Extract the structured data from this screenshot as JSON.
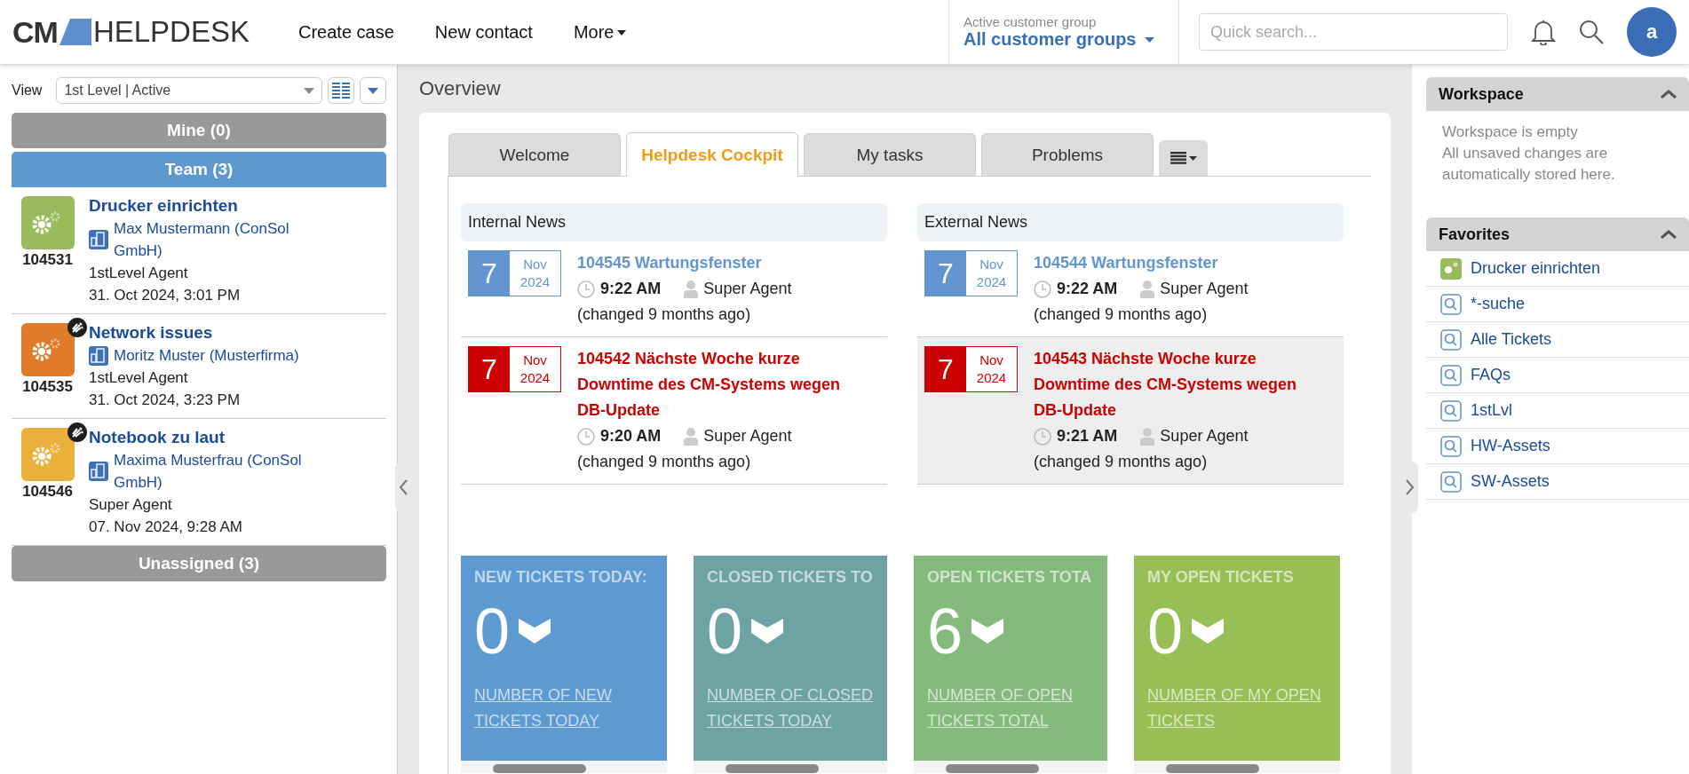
{
  "header": {
    "logo_left": "CM",
    "logo_right": "HELPDESK",
    "nav": [
      "Create case",
      "New contact",
      "More"
    ],
    "customer_group": {
      "label": "Active customer group",
      "value": "All customer groups"
    },
    "search": {
      "placeholder": "Quick search..."
    },
    "avatar": "a"
  },
  "sidebar": {
    "view_label": "View",
    "view_value": "1st Level | Active",
    "sections": [
      {
        "label": "Mine (0)",
        "selected": false
      },
      {
        "label": "Team (3)",
        "selected": true,
        "tickets": [
          {
            "title": "Drucker einrichten",
            "number": "104531",
            "contact": "Max Mustermann (ConSol GmbH)",
            "agent": "1stLevel Agent",
            "date": "31. Oct 2024, 3:01 PM",
            "color": "#9aba5e",
            "escalated": false
          },
          {
            "title": "Network issues",
            "number": "104535",
            "contact": "Moritz Muster (Musterfirma)",
            "agent": "1stLevel Agent",
            "date": "31. Oct 2024, 3:23 PM",
            "color": "#e07b2a",
            "escalated": true
          },
          {
            "title": "Notebook zu laut",
            "number": "104546",
            "contact": "Maxima Musterfrau (ConSol GmbH)",
            "agent": "Super Agent",
            "date": "07. Nov 2024, 9:28 AM",
            "color": "#ebb03c",
            "escalated": true
          }
        ]
      },
      {
        "label": "Unassigned (3)",
        "selected": false
      }
    ]
  },
  "overview": {
    "title": "Overview",
    "tabs": [
      {
        "label": "Welcome",
        "selected": false
      },
      {
        "label": "Helpdesk Cockpit",
        "selected": true
      },
      {
        "label": "My tasks",
        "selected": false
      },
      {
        "label": "Problems",
        "selected": false
      }
    ],
    "news": [
      {
        "title": "Internal News",
        "items": [
          {
            "day": "7",
            "month": "Nov",
            "year": "2024",
            "headline": "104545 Wartungsfenster",
            "time": "9:22 AM",
            "author": "Super Agent",
            "changed": "(changed 9 months ago)",
            "kind": "normal",
            "highlighted": false
          },
          {
            "day": "7",
            "month": "Nov",
            "year": "2024",
            "headline": "104542 Nächste Woche kurze Downtime des CM-Systems wegen DB-Update",
            "time": "9:20 AM",
            "author": "Super Agent",
            "changed": "(changed 9 months ago)",
            "kind": "urgent",
            "highlighted": false
          }
        ]
      },
      {
        "title": "External News",
        "items": [
          {
            "day": "7",
            "month": "Nov",
            "year": "2024",
            "headline": "104544 Wartungsfenster",
            "time": "9:22 AM",
            "author": "Super Agent",
            "changed": "(changed 9 months ago)",
            "kind": "normal",
            "highlighted": false
          },
          {
            "day": "7",
            "month": "Nov",
            "year": "2024",
            "headline": "104543 Nächste Woche kurze Downtime des CM-Systems wegen DB-Update",
            "time": "9:21 AM",
            "author": "Super Agent",
            "changed": "(changed 9 months ago)",
            "kind": "urgent",
            "highlighted": true
          }
        ]
      }
    ],
    "tiles": [
      {
        "title": "NEW TICKETS TODAY:",
        "value": "0",
        "link": "NUMBER OF NEW TICKETS TODAY",
        "color": "#5d9ad2"
      },
      {
        "title": "CLOSED TICKETS TO",
        "value": "0",
        "link": "NUMBER OF CLOSED TICKETS TODAY",
        "color": "#6ea3a4"
      },
      {
        "title": "OPEN TICKETS TOTA",
        "value": "6",
        "link": "NUMBER OF OPEN TICKETS TOTAL",
        "color": "#84ba7c"
      },
      {
        "title": "MY OPEN TICKETS",
        "value": "0",
        "link": "NUMBER OF MY OPEN TICKETS",
        "color": "#98be56"
      }
    ]
  },
  "workspace": {
    "title": "Workspace",
    "lines": [
      "Workspace is empty",
      "All unsaved changes are automatically stored here."
    ]
  },
  "favorites": {
    "title": "Favorites",
    "items": [
      {
        "label": "Drucker einrichten",
        "kind": "ticket"
      },
      {
        "label": "*-suche",
        "kind": "search"
      },
      {
        "label": "Alle Tickets",
        "kind": "search"
      },
      {
        "label": "FAQs",
        "kind": "search"
      },
      {
        "label": "1stLvl",
        "kind": "search"
      },
      {
        "label": "HW-Assets",
        "kind": "search"
      },
      {
        "label": "SW-Assets",
        "kind": "search"
      }
    ]
  }
}
